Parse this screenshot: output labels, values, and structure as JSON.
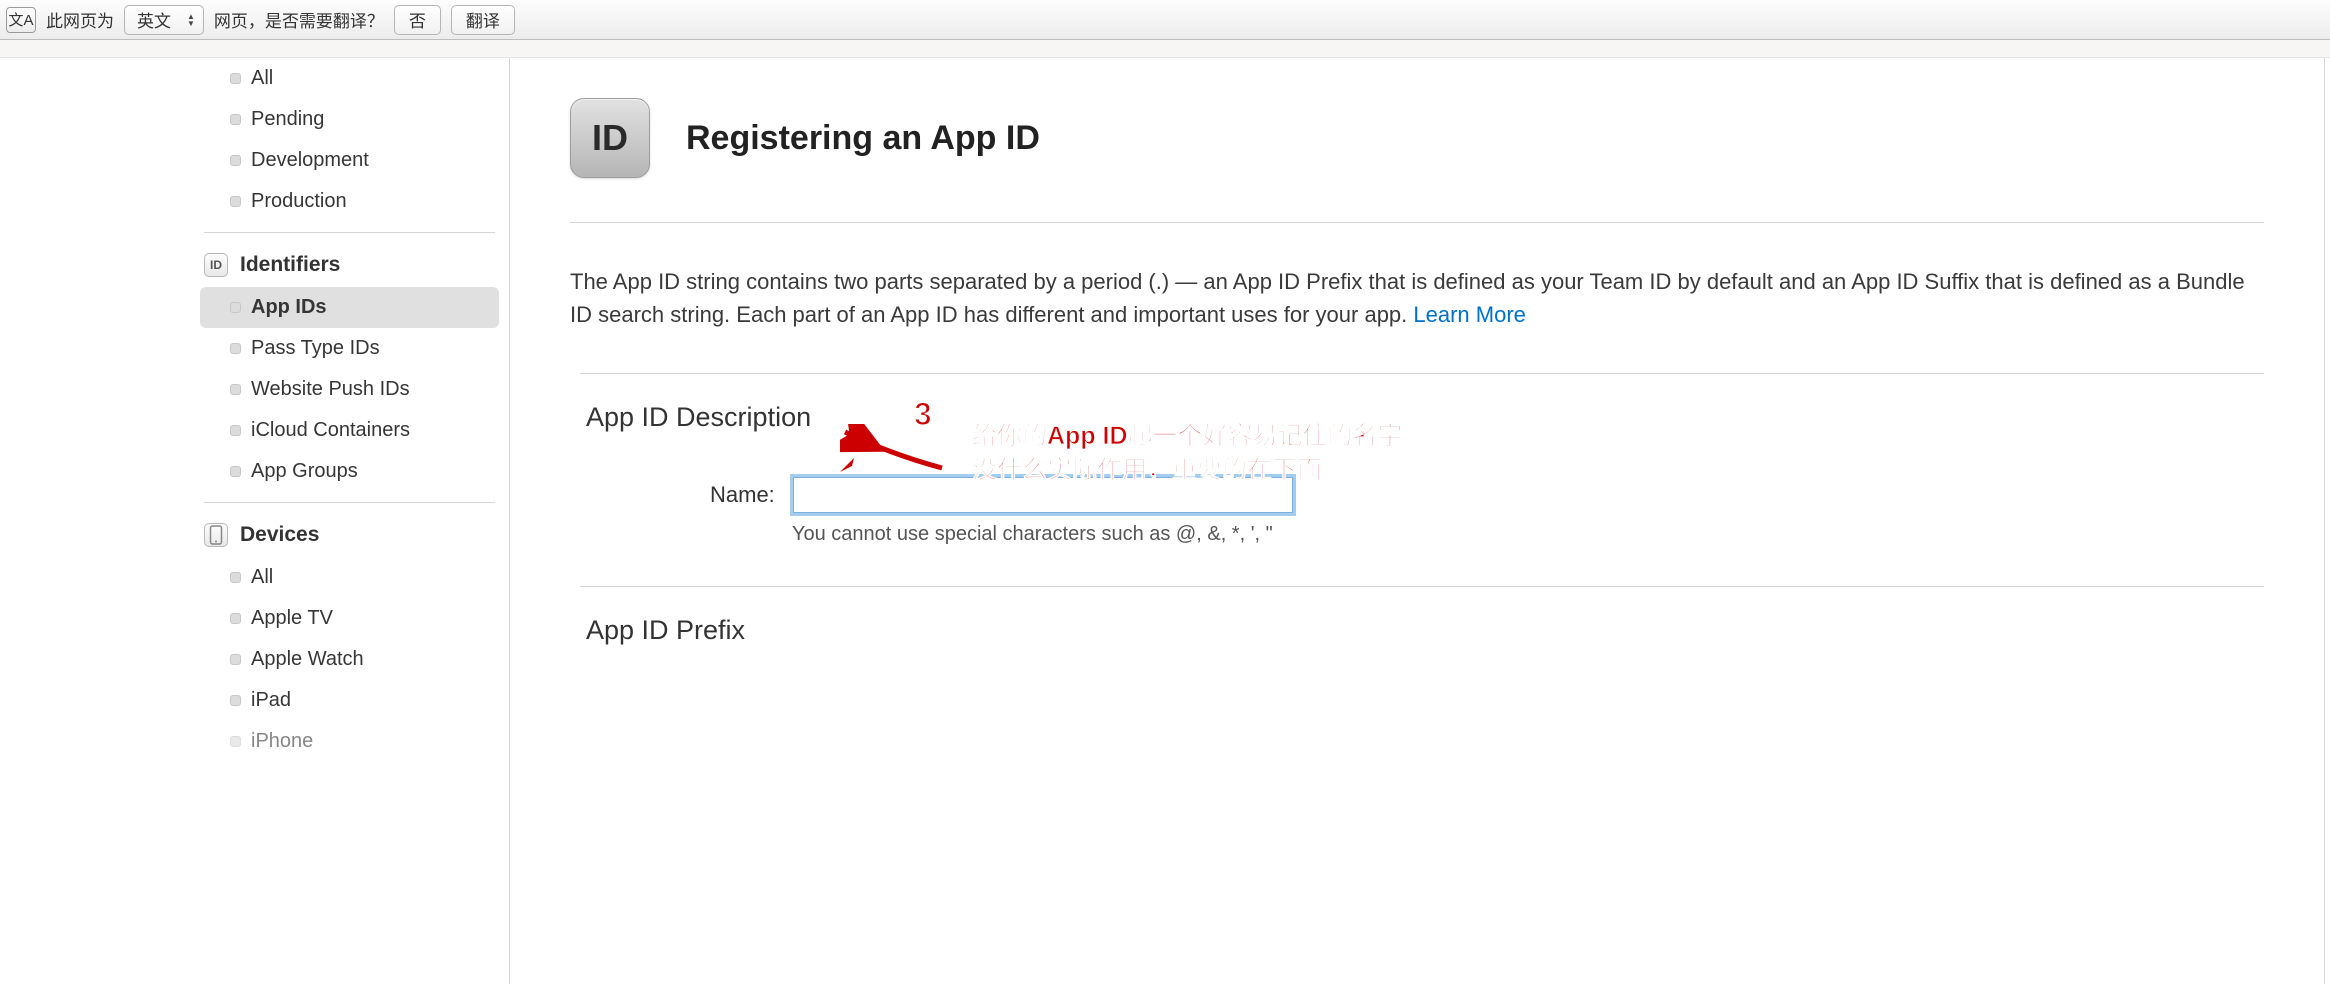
{
  "translate_bar": {
    "icon_text": "文A",
    "label_prefix": "此网页为",
    "lang": "英文",
    "label_suffix": "网页，是否需要翻译？",
    "btn_no": "否",
    "btn_translate": "翻译"
  },
  "sidebar": {
    "status_items": [
      {
        "label": "All"
      },
      {
        "label": "Pending"
      },
      {
        "label": "Development"
      },
      {
        "label": "Production"
      }
    ],
    "identifiers_header": "Identifiers",
    "identifiers_icon": "ID",
    "identifier_items": [
      {
        "label": "App IDs",
        "selected": true
      },
      {
        "label": "Pass Type IDs"
      },
      {
        "label": "Website Push IDs"
      },
      {
        "label": "iCloud Containers"
      },
      {
        "label": "App Groups"
      }
    ],
    "devices_header": "Devices",
    "device_items": [
      {
        "label": "All"
      },
      {
        "label": "Apple TV"
      },
      {
        "label": "Apple Watch"
      },
      {
        "label": "iPad"
      },
      {
        "label": "iPhone"
      }
    ]
  },
  "main": {
    "badge_text": "ID",
    "title": "Registering an App ID",
    "intro_text": "The App ID string contains two parts separated by a period (.) — an App ID Prefix that is defined as your Team ID by default and an App ID Suffix that is defined as a Bundle ID search string. Each part of an App ID has different and important uses for your app. ",
    "learn_more": "Learn More",
    "section_description": {
      "heading": "App ID Description",
      "name_label": "Name:",
      "name_value": "",
      "help": "You cannot use special characters such as @, &, *, ', \""
    },
    "section_prefix": {
      "heading": "App ID Prefix"
    }
  },
  "annotation": {
    "number": "3",
    "line1": "给你的App ID起一个好容易记住的名字",
    "line2": "没什么实际作用，重要的在下面"
  }
}
